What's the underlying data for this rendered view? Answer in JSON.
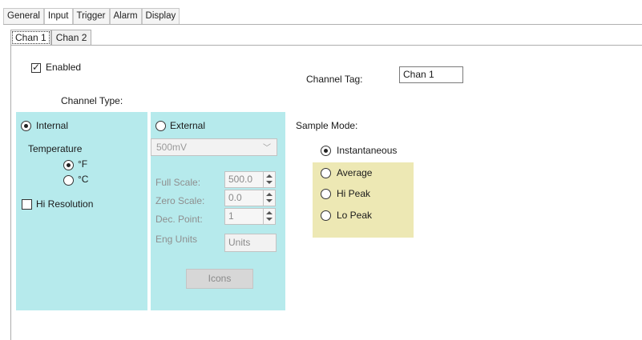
{
  "tabs": [
    "General",
    "Input",
    "Trigger",
    "Alarm",
    "Display"
  ],
  "channel_tabs": [
    "Chan 1",
    "Chan 2"
  ],
  "enabled": {
    "label": "Enabled",
    "checked": true
  },
  "channel_tag": {
    "label": "Channel Tag:",
    "value": "Chan 1"
  },
  "channel_type": {
    "label": "Channel Type:",
    "internal": {
      "label": "Internal",
      "selected": true,
      "temperature_label": "Temperature",
      "unit_f": "°F",
      "unit_c": "°C",
      "selected_unit": "°F",
      "hi_resolution": {
        "label": "Hi Resolution",
        "checked": false
      }
    },
    "external": {
      "label": "External",
      "selected": false,
      "range": "500mV",
      "full_scale": {
        "label": "Full Scale:",
        "value": "500.0"
      },
      "zero_scale": {
        "label": "Zero Scale:",
        "value": "0.0"
      },
      "dec_point": {
        "label": "Dec. Point:",
        "value": "1"
      },
      "eng_units": {
        "label": "Eng Units",
        "value": "Units"
      },
      "icons_button": "Icons"
    }
  },
  "sample_mode": {
    "label": "Sample Mode:",
    "options": [
      "Instantaneous",
      "Average",
      "Hi Peak",
      "Lo Peak"
    ],
    "selected": "Instantaneous"
  },
  "colors": {
    "cyan_highlight": "#b6eaec",
    "yellow_highlight": "#ede8b4"
  },
  "icons": [
    "check-icon",
    "chevron-down-icon",
    "spin-up-icon",
    "spin-down-icon"
  ]
}
